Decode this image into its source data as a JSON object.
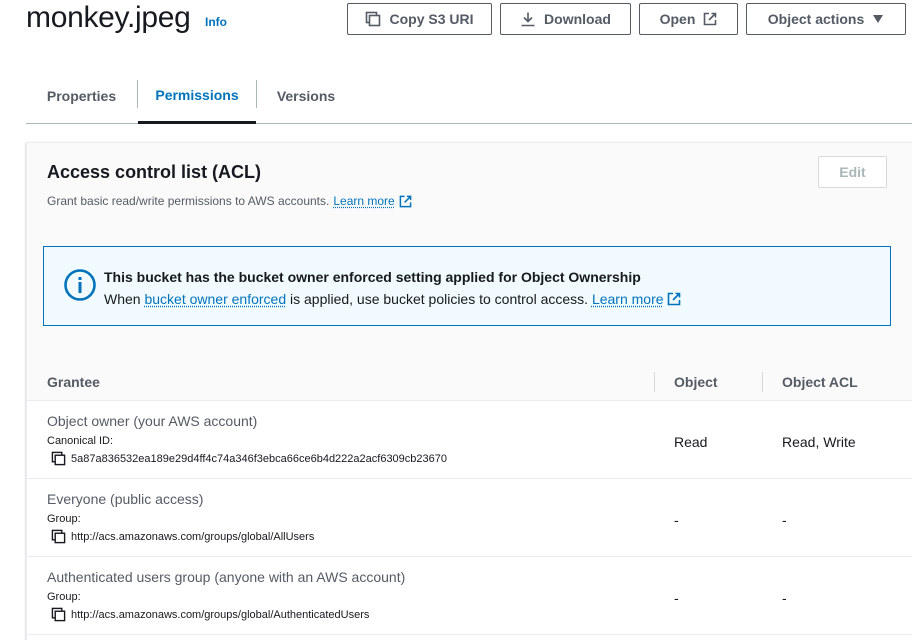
{
  "object": {
    "name": "monkey.jpeg",
    "info_label": "Info"
  },
  "actions": {
    "copy_s3_uri": "Copy S3 URI",
    "download": "Download",
    "open": "Open",
    "object_actions": "Object actions"
  },
  "tabs": [
    {
      "label": "Properties",
      "active": false
    },
    {
      "label": "Permissions",
      "active": true
    },
    {
      "label": "Versions",
      "active": false
    }
  ],
  "acl": {
    "title": "Access control list (ACL)",
    "description": "Grant basic read/write permissions to AWS accounts.",
    "learn_more": "Learn more",
    "edit_label": "Edit",
    "alert": {
      "title": "This bucket has the bucket owner enforced setting applied for Object Ownership",
      "body_prefix": "When",
      "body_link": "bucket owner enforced",
      "body_suffix": "is applied, use bucket policies to control access.",
      "learn_more": "Learn more"
    },
    "columns": {
      "grantee": "Grantee",
      "object": "Object",
      "object_acl": "Object ACL"
    },
    "rows": [
      {
        "grantee": "Object owner (your AWS account)",
        "id_label": "Canonical ID:",
        "id_value": "5a87a836532ea189e29d4ff4c74a346f3ebca66ce6b4d222a2acf6309cb23670",
        "object": "Read",
        "object_acl": "Read, Write"
      },
      {
        "grantee": "Everyone (public access)",
        "id_label": "Group:",
        "id_value": "http://acs.amazonaws.com/groups/global/AllUsers",
        "object": "-",
        "object_acl": "-"
      },
      {
        "grantee": "Authenticated users group (anyone with an AWS account)",
        "id_label": "Group:",
        "id_value": "http://acs.amazonaws.com/groups/global/AuthenticatedUsers",
        "object": "-",
        "object_acl": "-"
      }
    ]
  },
  "colors": {
    "link": "#0073bb",
    "text": "#16191f",
    "muted": "#545b64",
    "alert_bg": "#f1faff"
  },
  "icons": [
    "copy-icon",
    "download-icon",
    "external-link-icon",
    "caret-down-icon",
    "info-circle-icon"
  ]
}
